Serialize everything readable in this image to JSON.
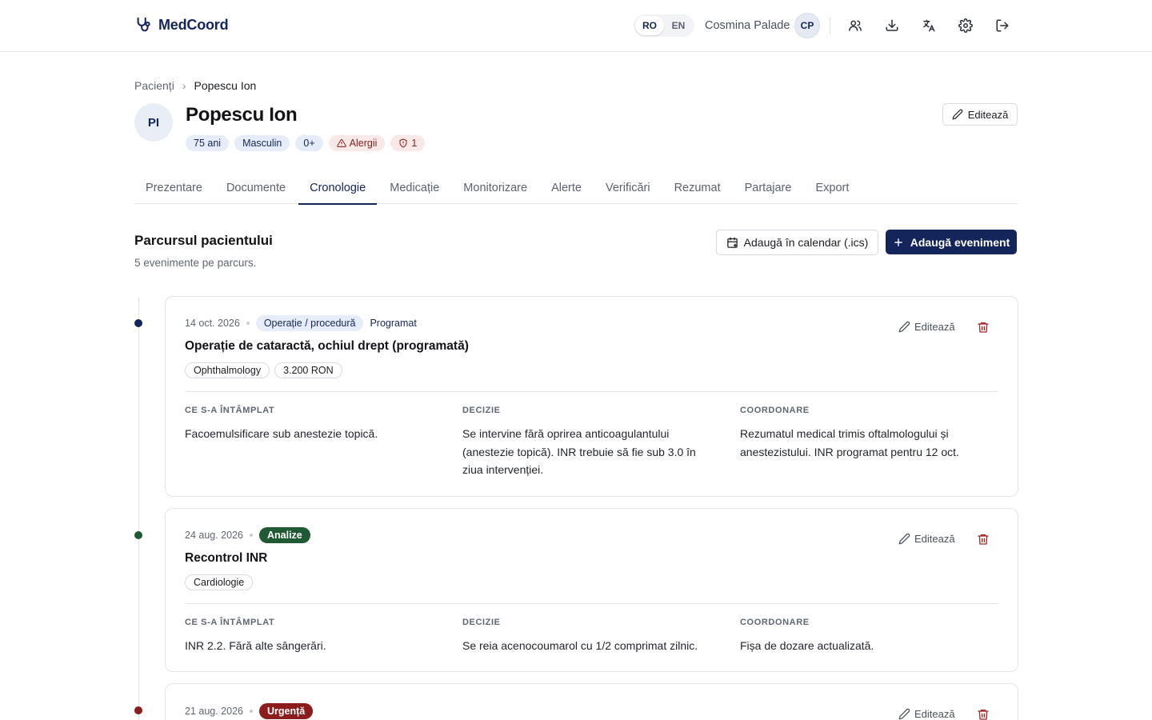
{
  "app": {
    "brand": "MedCoord"
  },
  "header": {
    "lang_ro": "RO",
    "lang_en": "EN",
    "user_name": "Cosmina Palade",
    "user_initials": "CP"
  },
  "breadcrumb": {
    "parent": "Pacienți",
    "separator": "›",
    "current": "Popescu Ion"
  },
  "patient": {
    "initials": "PI",
    "name": "Popescu Ion",
    "age": "75 ani",
    "sex": "Masculin",
    "blood_type": "0+",
    "allergy_label": "Alergii",
    "alert_count": "1",
    "edit_label": "Editează"
  },
  "tabs": [
    {
      "label": "Prezentare"
    },
    {
      "label": "Documente"
    },
    {
      "label": "Cronologie"
    },
    {
      "label": "Medicație"
    },
    {
      "label": "Monitorizare"
    },
    {
      "label": "Alerte"
    },
    {
      "label": "Verificări"
    },
    {
      "label": "Rezumat"
    },
    {
      "label": "Partajare"
    },
    {
      "label": "Export"
    }
  ],
  "active_tab": "Cronologie",
  "section": {
    "title": "Parcursul pacientului",
    "subtitle": "5 evenimente pe parcurs.",
    "calendar_button": "Adaugă în calendar (.ics)",
    "add_button": "Adaugă eveniment"
  },
  "colors": {
    "primary": "#14255c",
    "green": "#1f5a34",
    "red": "#8b1d1d"
  },
  "events": [
    {
      "date": "14 oct. 2026",
      "type": "Operație / procedură",
      "status": "Programat",
      "title": "Operație de cataractă, ochiul drept (programată)",
      "chips": [
        "Ophthalmology",
        "3.200 RON"
      ],
      "edit_label": "Editează",
      "what_label": "CE S-A ÎNTÂMPLAT",
      "what": "Facoemulsificare sub anestezie topică.",
      "decision_label": "DECIZIE",
      "decision": "Se intervine fără oprirea anticoagulantului (anestezie topică). INR trebuie să fie sub 3.0 în ziua intervenției.",
      "coord_label": "COORDONARE",
      "coord": "Rezumatul medical trimis oftalmologului și anestezistului. INR programat pentru 12 oct."
    },
    {
      "date": "24 aug. 2026",
      "type": "Analize",
      "title": "Recontrol INR",
      "chips": [
        "Cardiologie"
      ],
      "edit_label": "Editează",
      "what_label": "CE S-A ÎNTÂMPLAT",
      "what": "INR 2.2. Fără alte sângerări.",
      "decision_label": "DECIZIE",
      "decision": "Se reia acenocoumarol cu 1/2 comprimat zilnic.",
      "coord_label": "COORDONARE",
      "coord": "Fișa de dozare actualizată."
    },
    {
      "date": "21 aug. 2026",
      "type": "Urgență",
      "edit_label": "Editează"
    }
  ]
}
